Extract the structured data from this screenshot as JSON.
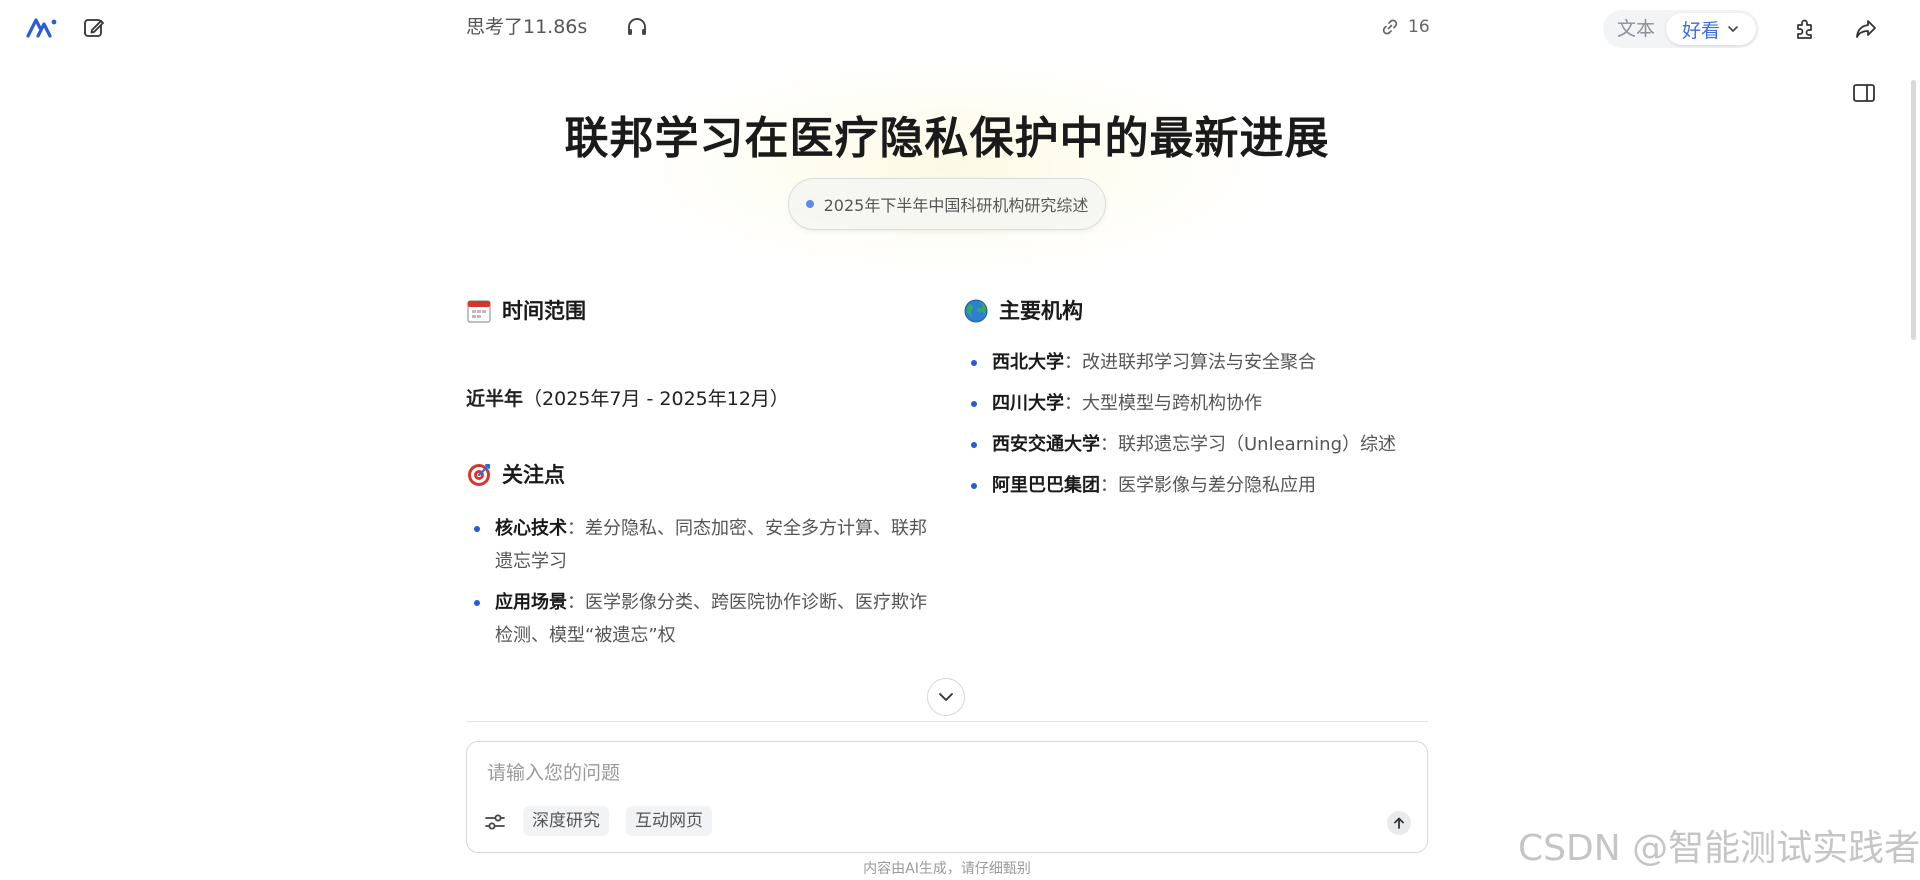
{
  "topbar": {
    "think_label": "思考了11.86s",
    "link_count": "16",
    "view_options": {
      "text": "文本",
      "nice": "好看"
    }
  },
  "hero": {
    "title": "联邦学习在医疗隐私保护中的最新进展",
    "subtitle": "2025年下半年中国科研机构研究综述"
  },
  "time_section": {
    "heading": "时间范围",
    "range_label": "近半年",
    "range_value": "（2025年7月 - 2025年12月）"
  },
  "focus_section": {
    "heading": "关注点",
    "items": [
      {
        "label": "核心技术",
        "text": "：差分隐私、同态加密、安全多方计算、联邦遗忘学习"
      },
      {
        "label": "应用场景",
        "text": "：医学影像分类、跨医院协作诊断、医疗欺诈检测、模型“被遗忘”权"
      }
    ]
  },
  "institutions_section": {
    "heading": "主要机构",
    "items": [
      {
        "label": "西北大学",
        "text": "：改进联邦学习算法与安全聚合"
      },
      {
        "label": "四川大学",
        "text": "：大型模型与跨机构协作"
      },
      {
        "label": "西安交通大学",
        "text": "：联邦遗忘学习（Unlearning）综述"
      },
      {
        "label": "阿里巴巴集团",
        "text": "：医学影像与差分隐私应用"
      }
    ]
  },
  "composer": {
    "placeholder": "请输入您的问题",
    "chips": {
      "deep": "深度研究",
      "web": "互动网页"
    },
    "disclaimer": "内容由AI生成，请仔细甄别"
  },
  "watermark": "CSDN @智能测试实践者",
  "colors": {
    "accent": "#3b6ee6",
    "bullet": "#2a5bd7",
    "title": "#1a1a1a"
  }
}
